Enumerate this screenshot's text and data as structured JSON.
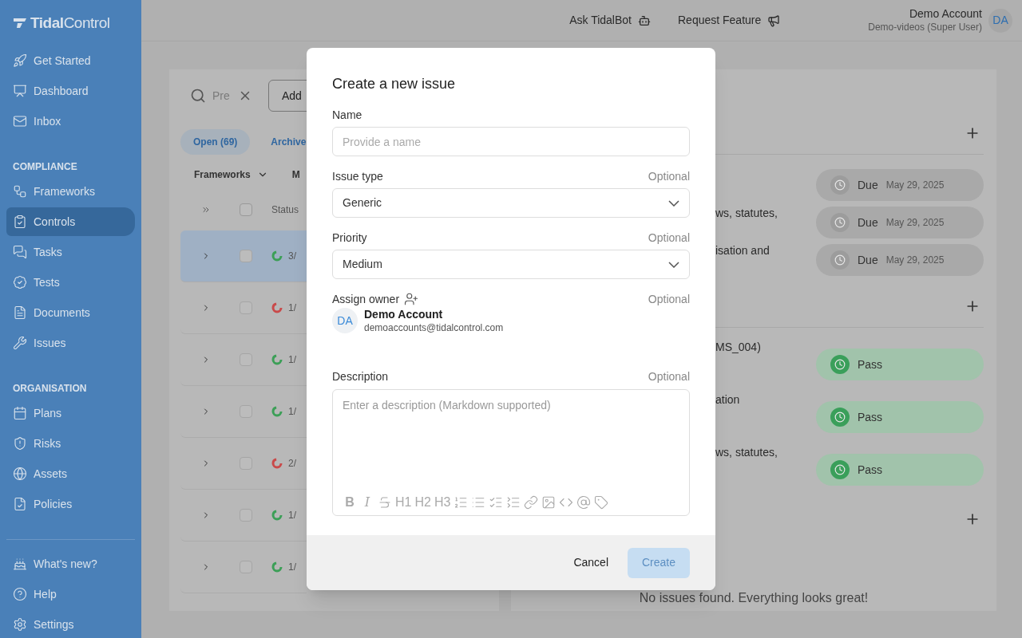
{
  "sidebar": {
    "logo": "**Tidal**Control",
    "sections": [
      {
        "items": [
          {
            "label": "Get Started",
            "selected": false
          },
          {
            "label": "Dashboard",
            "selected": false
          },
          {
            "label": "Inbox",
            "selected": false
          }
        ]
      },
      {
        "heading": "COMPLIANCE",
        "items": [
          {
            "label": "Frameworks",
            "selected": false
          },
          {
            "label": "Controls",
            "selected": true
          },
          {
            "label": "Tasks",
            "selected": false
          },
          {
            "label": "Tests",
            "selected": false
          },
          {
            "label": "Documents",
            "selected": false
          },
          {
            "label": "Issues",
            "selected": false
          }
        ]
      },
      {
        "heading": "ORGANISATION",
        "items": [
          {
            "label": "Plans",
            "selected": false
          },
          {
            "label": "Risks",
            "selected": false
          },
          {
            "label": "Assets",
            "selected": false
          },
          {
            "label": "Policies",
            "selected": false
          }
        ]
      },
      {
        "items": [
          {
            "label": "What's new?",
            "selected": false
          },
          {
            "label": "Help",
            "selected": false
          },
          {
            "label": "Settings",
            "selected": false
          }
        ]
      }
    ]
  },
  "top_bar": {
    "links": [
      {
        "label": "Ask TidalBot"
      },
      {
        "label": "Request Feature"
      }
    ],
    "account": {
      "name": "Demo Account",
      "org": "Demo-videos (Super User)",
      "initials": "DA"
    }
  },
  "controls_panel": {
    "search": {
      "placeholder": "Pre"
    },
    "add_button": "Add",
    "tabs": [
      {
        "label": "Open (69)",
        "selected": true
      },
      {
        "label": "Archive",
        "selected": false
      }
    ],
    "filters": [
      "Frameworks",
      "M"
    ],
    "header": {
      "status": "Status",
      "checked": false
    },
    "rows": [
      {
        "status": "3/",
        "color": "#3c9f57",
        "selected": true,
        "checked": false
      },
      {
        "status": "1/",
        "color": "#c94a4a",
        "selected": false,
        "checked": false
      },
      {
        "status": "1/",
        "color": "#3c9f57",
        "selected": false,
        "checked": false
      },
      {
        "status": "1/",
        "color": "#3c9f57",
        "selected": false,
        "checked": false
      },
      {
        "status": "2/",
        "color": "#c94a4a",
        "selected": false,
        "checked": false
      },
      {
        "status": "1/",
        "color": "#3c9f57",
        "selected": false,
        "checked": false
      },
      {
        "status": "1/",
        "color": "#3c9f57",
        "selected": false,
        "checked": false
      }
    ]
  },
  "detail_panel": {
    "sections": [
      {
        "rows": [
          {
            "text": "",
            "badge": {
              "kind": "due",
              "label": "Due",
              "date": "May 29, 2025"
            }
          },
          {
            "text": "ws, statutes,",
            "badge": {
              "kind": "due",
              "label": "Due",
              "date": "May 29, 2025"
            }
          },
          {
            "text": "isation and",
            "badge": {
              "kind": "due",
              "label": "Due",
              "date": "May 29, 2025"
            }
          }
        ]
      },
      {
        "rows": [
          {
            "text": "MS_004)",
            "badge": {
              "kind": "pass",
              "label": "Pass"
            }
          },
          {
            "text": "ation",
            "badge": {
              "kind": "pass",
              "label": "Pass"
            }
          },
          {
            "text": "ws, statutes,",
            "badge": {
              "kind": "pass",
              "label": "Pass"
            }
          }
        ]
      },
      {
        "empty": "No issues found. Everything looks great!"
      }
    ]
  },
  "dialog": {
    "title": "Create a new issue",
    "fields": [
      {
        "kind": "text",
        "label": "Name",
        "placeholder": "Provide a name"
      },
      {
        "kind": "select",
        "label": "Issue type",
        "optional": "Optional",
        "value": "Generic"
      },
      {
        "kind": "select",
        "label": "Priority",
        "optional": "Optional",
        "value": "Medium"
      },
      {
        "kind": "owner",
        "label": "Assign owner",
        "optional": "Optional",
        "initials": "DA",
        "name": "Demo Account",
        "email": "demoaccounts@tidalcontrol.com"
      },
      {
        "kind": "editor",
        "label": "Description",
        "optional": "Optional",
        "placeholder": "Enter a description (Markdown supported)",
        "toolbar": [
          {
            "kind": "bold",
            "label": "B"
          },
          {
            "kind": "italic",
            "label": "I"
          },
          {
            "kind": "strike"
          },
          {
            "kind": "heading",
            "label": "H1"
          },
          {
            "kind": "heading",
            "label": "H2"
          },
          {
            "kind": "heading",
            "label": "H3"
          },
          {
            "kind": "ordered-list"
          },
          {
            "kind": "bullet-list"
          },
          {
            "kind": "task-list"
          },
          {
            "kind": "indent"
          },
          {
            "kind": "link"
          },
          {
            "kind": "image"
          },
          {
            "kind": "code"
          },
          {
            "kind": "mention"
          },
          {
            "kind": "tag"
          }
        ]
      }
    ],
    "cancel": "Cancel",
    "create": {
      "label": "Create",
      "disabled": true
    }
  }
}
